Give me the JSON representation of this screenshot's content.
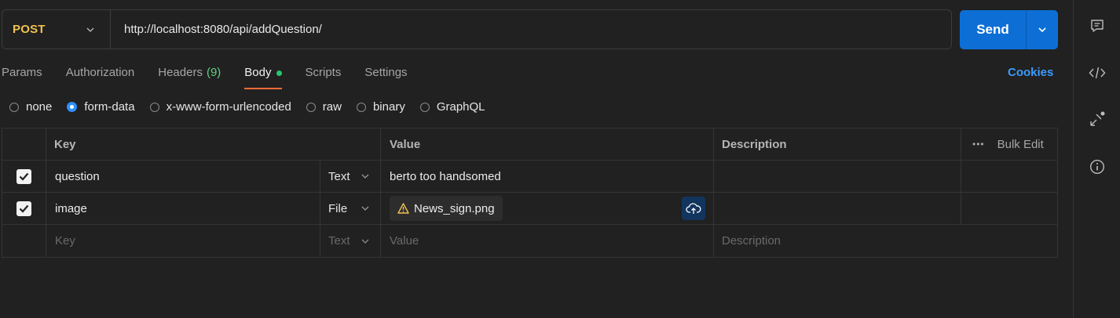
{
  "request": {
    "method": "POST",
    "url": "http://localhost:8080/api/addQuestion/",
    "send_label": "Send"
  },
  "tabs": [
    {
      "label": "Params"
    },
    {
      "label": "Authorization"
    },
    {
      "label": "Headers",
      "count": "(9)"
    },
    {
      "label": "Body",
      "active": true
    },
    {
      "label": "Scripts"
    },
    {
      "label": "Settings"
    }
  ],
  "cookies_label": "Cookies",
  "body_types": [
    "none",
    "form-data",
    "x-www-form-urlencoded",
    "raw",
    "binary",
    "GraphQL"
  ],
  "body_type_selected": "form-data",
  "table": {
    "headers": {
      "key": "Key",
      "value": "Value",
      "description": "Description",
      "bulk_edit": "Bulk Edit"
    },
    "rows": [
      {
        "key": "question",
        "type": "Text",
        "value": "berto too handsomed",
        "checked": true
      },
      {
        "key": "image",
        "type": "File",
        "file_name": "News_sign.png",
        "checked": true
      }
    ],
    "placeholder": {
      "key": "Key",
      "type": "Text",
      "value": "Value",
      "description": "Description"
    }
  },
  "sidebar_icons": [
    "comment-icon",
    "code-icon",
    "related-collections-icon",
    "info-icon"
  ],
  "colors": {
    "method": "#f1c24f",
    "send_button": "#0d6fd6",
    "active_tab_underline": "#ff6c37",
    "headers_count": "#5fcf80",
    "body_dot": "#28c76f",
    "cookies_link": "#3b9bff",
    "radio_selected": "#2e8fff"
  }
}
